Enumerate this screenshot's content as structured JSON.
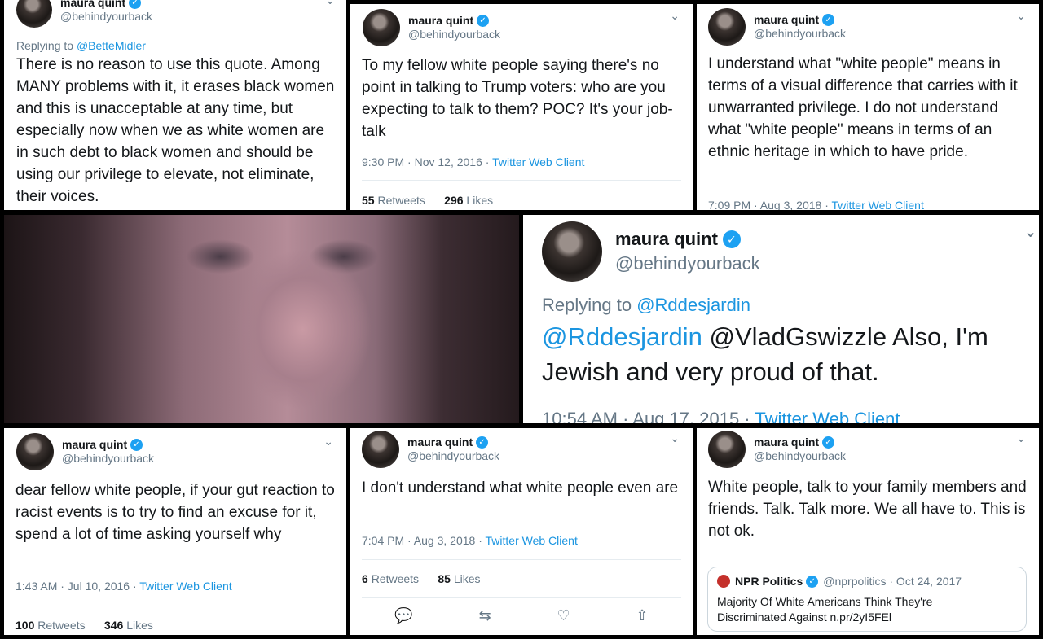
{
  "verified_mark": "✓",
  "chevron": "⌄",
  "tweets": [
    {
      "name": "maura quint",
      "handle": "@behindyourback",
      "replying_to_prefix": "Replying to",
      "replying_to": "@BetteMidler",
      "text": "There is no reason to use this quote. Among MANY problems with it, it erases black women and this is unacceptable at any time, but especially now when we as white women are in such debt to black women and should be using our privilege to elevate, not eliminate, their voices."
    },
    {
      "name": "maura quint",
      "handle": "@behindyourback",
      "text": "To my fellow white people saying there's no point in talking to Trump voters: who are you expecting to talk to them? POC? It's your job-talk",
      "time": "9:30 PM · Nov 12, 2016 ·",
      "client": "Twitter Web Client",
      "retweets": "55",
      "retweets_label": "Retweets",
      "likes": "296",
      "likes_label": "Likes"
    },
    {
      "name": "maura quint",
      "handle": "@behindyourback",
      "text": "I understand what \"white people\" means in terms of a visual difference that carries with it unwarranted privilege. I do not understand what \"white people\" means in terms of an ethnic heritage in which to have pride.",
      "time": "7:09 PM · Aug 3, 2018 ·",
      "client": "Twitter Web Client"
    },
    {
      "name": "maura quint",
      "handle": "@behindyourback",
      "replying_to_prefix": "Replying to",
      "replying_to": "@Rddesjardin",
      "mention": "@Rddesjardin",
      "text": "@VladGswizzle Also, I'm Jewish and very proud of that.",
      "time": "10:54 AM · Aug 17, 2015 ·",
      "client": "Twitter Web Client"
    },
    {
      "name": "maura quint",
      "handle": "@behindyourback",
      "text": "dear fellow white people, if your gut reaction to racist events is to try to find an excuse for it, spend a lot of time asking yourself why",
      "time": "1:43 AM · Jul 10, 2016 ·",
      "client": "Twitter Web Client",
      "retweets": "100",
      "retweets_label": "Retweets",
      "likes": "346",
      "likes_label": "Likes"
    },
    {
      "name": "maura quint",
      "handle": "@behindyourback",
      "text": "I don't understand what white people even are",
      "time": "7:04 PM · Aug 3, 2018 ·",
      "client": "Twitter Web Client",
      "retweets": "6",
      "retweets_label": "Retweets",
      "likes": "85",
      "likes_label": "Likes"
    },
    {
      "name": "maura quint",
      "handle": "@behindyourback",
      "text": "White people, talk to your family members and friends. Talk. Talk more. We all have to. This is not ok.",
      "quote": {
        "name": "NPR Politics",
        "handle": "@nprpolitics · Oct 24, 2017",
        "text": "Majority Of White Americans Think They're Discriminated Against n.pr/2yI5FEl"
      }
    }
  ],
  "actions": [
    "💬",
    "⇆",
    "♡",
    "⇧"
  ]
}
